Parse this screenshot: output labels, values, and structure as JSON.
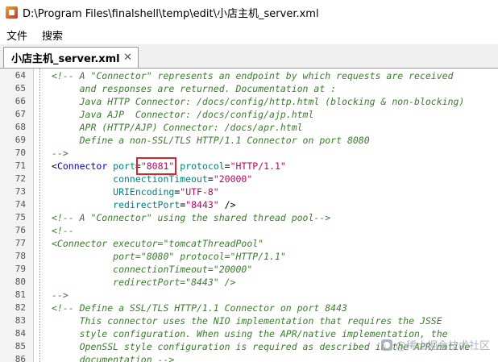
{
  "window": {
    "title": "D:\\Program Files\\finalshell\\temp\\edit\\小店主机_server.xml"
  },
  "menu": [
    "文件",
    "搜索"
  ],
  "tab": {
    "label": "小店主机_server.xml",
    "close": "✕"
  },
  "editor": {
    "lines": [
      {
        "num": "64",
        "code": [
          {
            "t": "cm",
            "v": "<!-- A \"Connector\" represents an endpoint by which requests are received"
          }
        ]
      },
      {
        "num": "65",
        "code": [
          {
            "t": "cm",
            "v": "     and responses are returned. Documentation at :"
          }
        ]
      },
      {
        "num": "66",
        "code": [
          {
            "t": "cm",
            "v": "     Java HTTP Connector: /docs/config/http.html (blocking & non-blocking)"
          }
        ]
      },
      {
        "num": "67",
        "code": [
          {
            "t": "cm",
            "v": "     Java AJP  Connector: /docs/config/ajp.html"
          }
        ]
      },
      {
        "num": "68",
        "code": [
          {
            "t": "cm",
            "v": "     APR (HTTP/AJP) Connector: /docs/apr.html"
          }
        ]
      },
      {
        "num": "69",
        "code": [
          {
            "t": "cm",
            "v": "     Define a non-SSL/TLS HTTP/1.1 Connector on port 8080"
          }
        ]
      },
      {
        "num": "70",
        "code": [
          {
            "t": "cm",
            "v": "-->"
          }
        ]
      },
      {
        "num": "71",
        "code": [
          {
            "t": "punct",
            "v": "<"
          },
          {
            "t": "tag",
            "v": "Connector"
          },
          {
            "t": "attr",
            "v": " port"
          },
          {
            "t": "punct",
            "v": "="
          },
          {
            "t": "val",
            "v": "\"8081\""
          },
          {
            "t": "attr",
            "v": " protocol"
          },
          {
            "t": "punct",
            "v": "="
          },
          {
            "t": "val",
            "v": "\"HTTP/1.1\""
          }
        ]
      },
      {
        "num": "72",
        "code": [
          {
            "t": "attr",
            "v": "           connectionTimeout"
          },
          {
            "t": "punct",
            "v": "="
          },
          {
            "t": "val",
            "v": "\"20000\""
          }
        ]
      },
      {
        "num": "73",
        "code": [
          {
            "t": "attr",
            "v": "           URIEncoding"
          },
          {
            "t": "punct",
            "v": "="
          },
          {
            "t": "val",
            "v": "\"UTF-8\""
          }
        ]
      },
      {
        "num": "74",
        "code": [
          {
            "t": "attr",
            "v": "           redirectPort"
          },
          {
            "t": "punct",
            "v": "="
          },
          {
            "t": "val",
            "v": "\"8443\""
          },
          {
            "t": "punct",
            "v": " />"
          }
        ]
      },
      {
        "num": "75",
        "code": [
          {
            "t": "cm",
            "v": "<!-- A \"Connector\" using the shared thread pool-->"
          }
        ]
      },
      {
        "num": "76",
        "code": [
          {
            "t": "cm",
            "v": "<!--"
          }
        ]
      },
      {
        "num": "77",
        "code": [
          {
            "t": "cm",
            "v": "<Connector executor=\"tomcatThreadPool\""
          }
        ]
      },
      {
        "num": "78",
        "code": [
          {
            "t": "cm",
            "v": "           port=\"8080\" protocol=\"HTTP/1.1\""
          }
        ]
      },
      {
        "num": "79",
        "code": [
          {
            "t": "cm",
            "v": "           connectionTimeout=\"20000\""
          }
        ]
      },
      {
        "num": "80",
        "code": [
          {
            "t": "cm",
            "v": "           redirectPort=\"8443\" />"
          }
        ]
      },
      {
        "num": "81",
        "code": [
          {
            "t": "cm",
            "v": "-->"
          }
        ]
      },
      {
        "num": "82",
        "code": [
          {
            "t": "cm",
            "v": "<!-- Define a SSL/TLS HTTP/1.1 Connector on port 8443"
          }
        ]
      },
      {
        "num": "83",
        "code": [
          {
            "t": "cm",
            "v": "     This connector uses the NIO implementation that requires the JSSE"
          }
        ]
      },
      {
        "num": "84",
        "code": [
          {
            "t": "cm",
            "v": "     style configuration. When using the APR/native implementation, the"
          }
        ]
      },
      {
        "num": "85",
        "code": [
          {
            "t": "cm",
            "v": "     OpenSSL style configuration is required as described in the APR/native"
          }
        ]
      },
      {
        "num": "86",
        "code": [
          {
            "t": "cm",
            "v": "     documentation -->"
          }
        ]
      }
    ]
  },
  "watermark": "@稀土掘金技术社区",
  "colors": {
    "comment": "#3a7d2c",
    "tag": "#0000c0",
    "attribute": "#008080",
    "value": "#c00060",
    "highlight": "#d9232d"
  }
}
